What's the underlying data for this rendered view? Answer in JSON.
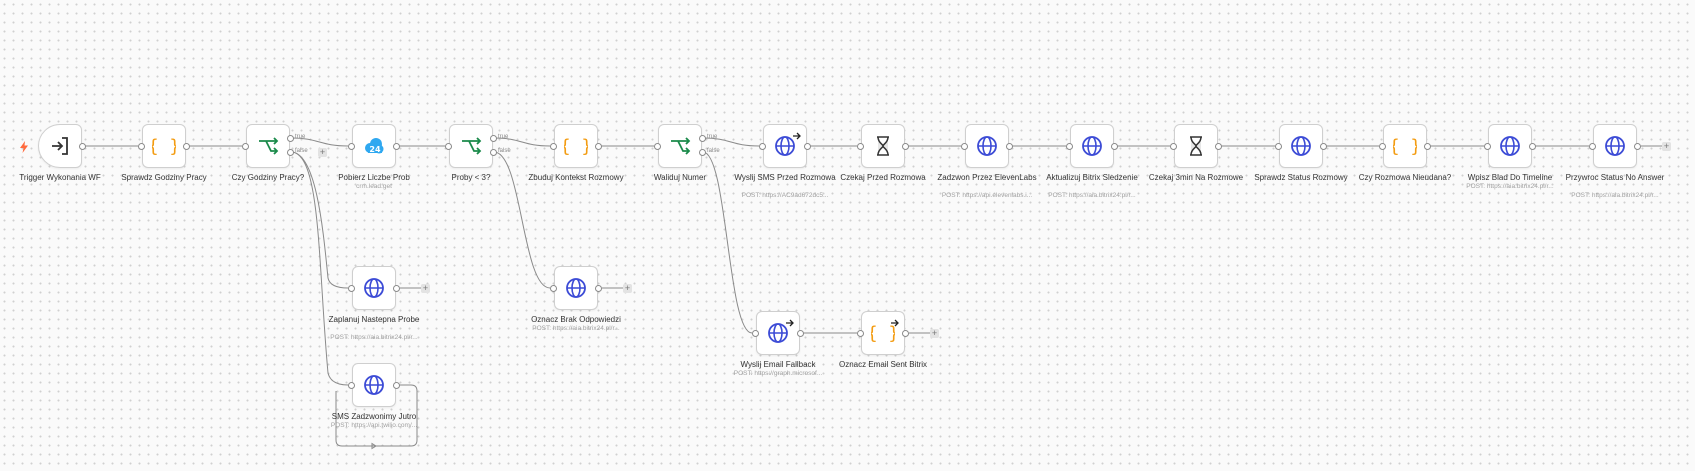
{
  "canvas": {
    "colors": {
      "edge": "#8a8a8a",
      "globe": "#3c4bd6",
      "brace": "#f39c12",
      "switch": "#1a8a4a",
      "bitrix": "#2fa8f0",
      "trigger_bolt": "#ff6a3d"
    }
  },
  "nodes": [
    {
      "id": "trigger",
      "label": "Trigger Wykonania WF",
      "sub": "",
      "icon": "enter-icon"
    },
    {
      "id": "work-hours",
      "label": "Sprawdz Godziny Pracy",
      "sub": "",
      "icon": "braces-icon"
    },
    {
      "id": "if-hours",
      "label": "Czy Godziny Pracy?",
      "sub": "",
      "icon": "switch-icon"
    },
    {
      "id": "get-attempts",
      "label": "Pobierz Liczbe Prob",
      "sub": "crm.lead.get",
      "icon": "bitrix-icon"
    },
    {
      "id": "if-attempts",
      "label": "Proby < 3?",
      "sub": "",
      "icon": "switch-icon"
    },
    {
      "id": "build-context",
      "label": "Zbuduj Kontekst Rozmowy",
      "sub": "",
      "icon": "braces-icon"
    },
    {
      "id": "validate-number",
      "label": "Waliduj Numer",
      "sub": "",
      "icon": "switch-icon"
    },
    {
      "id": "send-sms",
      "label": "Wyslij SMS Przed Rozmowa",
      "sub": "POST: https://AC9ad672dc5...",
      "icon": "globe-icon"
    },
    {
      "id": "wait-before",
      "label": "Czekaj Przed Rozmowa",
      "sub": "",
      "icon": "hourglass-icon"
    },
    {
      "id": "call-eleven",
      "label": "Zadzwon Przez ElevenLabs",
      "sub": "POST: https://api.elevenlabs.i...",
      "icon": "globe-icon"
    },
    {
      "id": "update-bitrix",
      "label": "Aktualizuj Bitrix Sledzenie",
      "sub": "POST: https://aia.bitrix24.pl/r...",
      "icon": "globe-icon"
    },
    {
      "id": "wait-3min",
      "label": "Czekaj 3min Na Rozmowe",
      "sub": "",
      "icon": "hourglass-icon"
    },
    {
      "id": "check-status",
      "label": "Sprawdz Status Rozmowy",
      "sub": "",
      "icon": "globe-icon"
    },
    {
      "id": "if-failed",
      "label": "Czy Rozmowa Nieudana?",
      "sub": "",
      "icon": "braces-icon"
    },
    {
      "id": "error-timeline",
      "label": "Wpisz Blad Do Timeline",
      "sub": "POST: https://aia.bitrix24.pl/r...",
      "icon": "globe-icon"
    },
    {
      "id": "restore-status",
      "label": "Przywroc Status No Answer",
      "sub": "POST: https://aia.bitrix24.pl/r...",
      "icon": "globe-icon"
    },
    {
      "id": "schedule-next",
      "label": "Zaplanuj Nastepna Probe",
      "sub": "POST: https://aia.bitrix24.pl/r...",
      "icon": "globe-icon"
    },
    {
      "id": "sms-tomorrow",
      "label": "SMS Zadzwonimy Jutro",
      "sub": "POST: https://api.twilio.com/...",
      "icon": "globe-icon"
    },
    {
      "id": "mark-no-answer",
      "label": "Oznacz Brak Odpowiedzi",
      "sub": "POST: https://aia.bitrix24.pl/r...",
      "icon": "globe-icon"
    },
    {
      "id": "send-email",
      "label": "Wyslij Email Fallback",
      "sub": "POST: https://graph.microsof...",
      "icon": "globe-icon"
    },
    {
      "id": "mark-email-sent",
      "label": "Oznacz Email Sent Bitrix",
      "sub": "",
      "icon": "braces-icon"
    }
  ],
  "branch_labels": {
    "true": "true",
    "false": "false"
  },
  "add_button_label": "+"
}
